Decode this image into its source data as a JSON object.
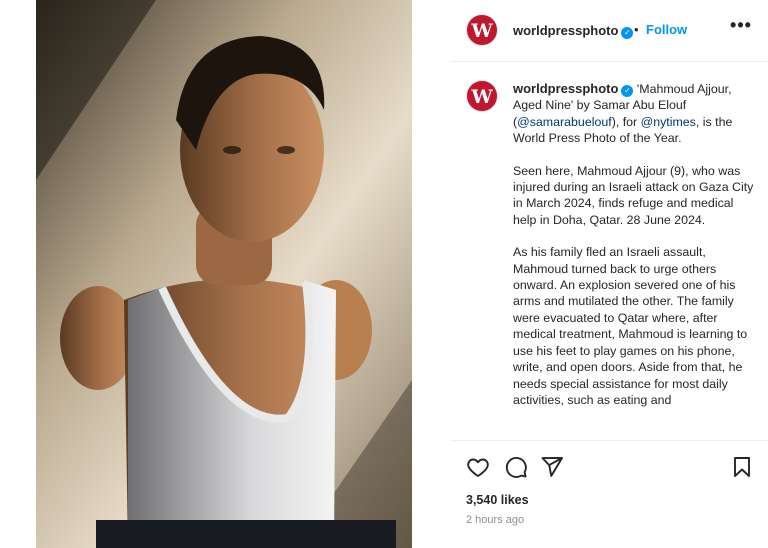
{
  "post": {
    "photo_alt": "Portrait of Mahmoud Ajjour"
  },
  "header": {
    "avatar_letter": "W",
    "username": "worldpressphoto",
    "verified_glyph": "✓",
    "separator": "•",
    "follow_label": "Follow",
    "more_label": "•••"
  },
  "caption": {
    "avatar_letter": "W",
    "username": "worldpressphoto",
    "verified_glyph": "✓",
    "p1_a": " 'Mahmoud Ajjour, Aged Nine' by Samar Abu Elouf (",
    "p1_mention1": "@samarabuelouf",
    "p1_b": "), for ",
    "p1_mention2": "@nytimes",
    "p1_c": ", is the World Press Photo of the Year.",
    "p2": "Seen here, Mahmoud Ajjour (9), who was injured during an Israeli attack on Gaza City in March 2024, finds refuge and medical help in Doha, Qatar. 28 June 2024.",
    "p3": "As his family fled an Israeli assault, Mahmoud turned back to urge others onward. An explosion severed one of his arms and mutilated the other. The family were evacuated to Qatar where, after medical treatment, Mahmoud is learning to use his feet to play games on his phone, write, and open doors. Aside from that, he needs special assistance for most daily activities, such as eating and"
  },
  "actions": {
    "icons": [
      "heart-icon",
      "comment-icon",
      "share-icon",
      "bookmark-icon"
    ],
    "likes": "3,540 likes",
    "time": "2 hours ago"
  },
  "colors": {
    "brand": "#c0162e",
    "link": "#0095f6",
    "mention": "#00376b",
    "muted": "#8e8e8e"
  }
}
